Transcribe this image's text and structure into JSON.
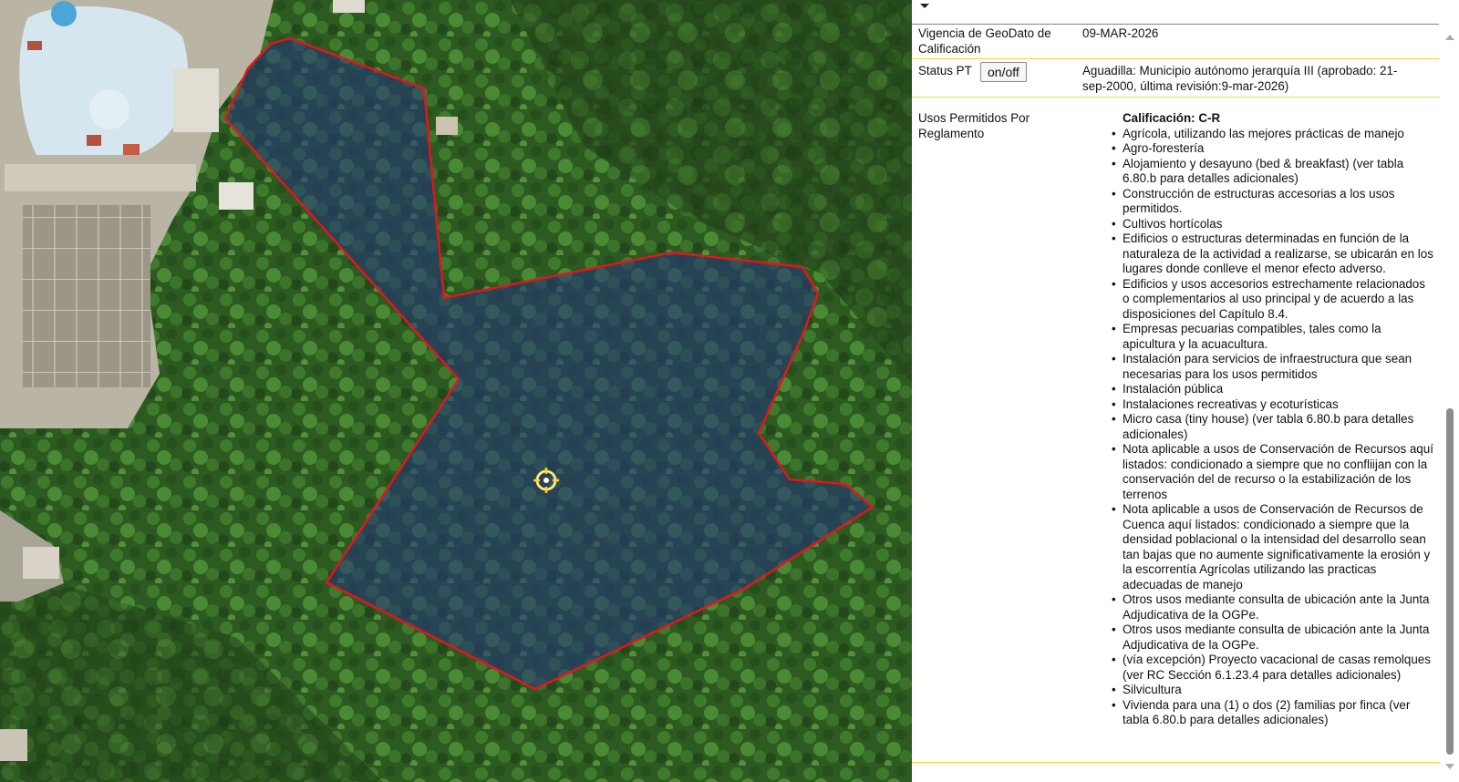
{
  "colors": {
    "parcel_outline": "#e8141b",
    "parcel_fill": "#25357a",
    "row_separator": "#f2d63a",
    "location_marker": "#ffd23a"
  },
  "map": {
    "marker_icon": "crosshair-target-icon"
  },
  "panel": {
    "rows": [
      {
        "label": "Vigencia de GeoDato de Calificación",
        "value": "09-MAR-2026"
      },
      {
        "label": "Status PT",
        "button": "on/off",
        "value": "Aguadilla: Municipio autónomo jerarquía III (aprobado: 21-sep-2000, última revisión:9-mar-2026)"
      }
    ],
    "usos": {
      "label": "Usos Permitidos Por Reglamento",
      "calificacion": "Calificación: C-R",
      "items": [
        "Agrícola, utilizando las mejores prácticas de manejo",
        "Agro-forestería",
        "Alojamiento y desayuno (bed & breakfast) (ver tabla 6.80.b para detalles adicionales)",
        "Construcción de estructuras accesorias a los usos permitidos.",
        "Cultivos hortícolas",
        "Edificios o estructuras determinadas en función de la naturaleza de la actividad a realizarse, se ubicarán en los lugares donde conlleve el menor efecto adverso.",
        "Edificios y usos accesorios estrechamente relacionados o complementarios al uso principal y de acuerdo a las disposiciones del Capítulo 8.4.",
        "Empresas pecuarias compatibles, tales como la apicultura y la acuacultura.",
        "Instalación para servicios de infraestructura que sean necesarias para los usos permitidos",
        "Instalación pública",
        "Instalaciones recreativas y ecoturísticas",
        "Micro casa (tiny house) (ver tabla 6.80.b para detalles adicionales)",
        "Nota aplicable a usos de Conservación de Recursos aquí listados: condicionado a siempre que no confliijan con la conservación del de recurso o la estabilización de los terrenos",
        "Nota aplicable a usos de Conservación de Recursos de Cuenca aquí listados: condicionado a siempre que la densidad poblacional o la intensidad del desarrollo sean tan bajas que no aumente significativamente la erosión y la escorrentía Agrícolas utilizando las practicas adecuadas de manejo",
        "Otros usos mediante consulta de ubicación ante la Junta Adjudicativa de la OGPe.",
        "Otros usos mediante consulta de ubicación ante la Junta Adjudicativa de la OGPe.",
        "(vía excepción) Proyecto vacacional de casas remolques (ver RC Sección 6.1.23.4 para detalles adicionales)",
        "Silvicultura",
        "Vivienda para una (1) o dos (2) familias por finca (ver tabla 6.80.b para detalles adicionales)"
      ]
    }
  }
}
